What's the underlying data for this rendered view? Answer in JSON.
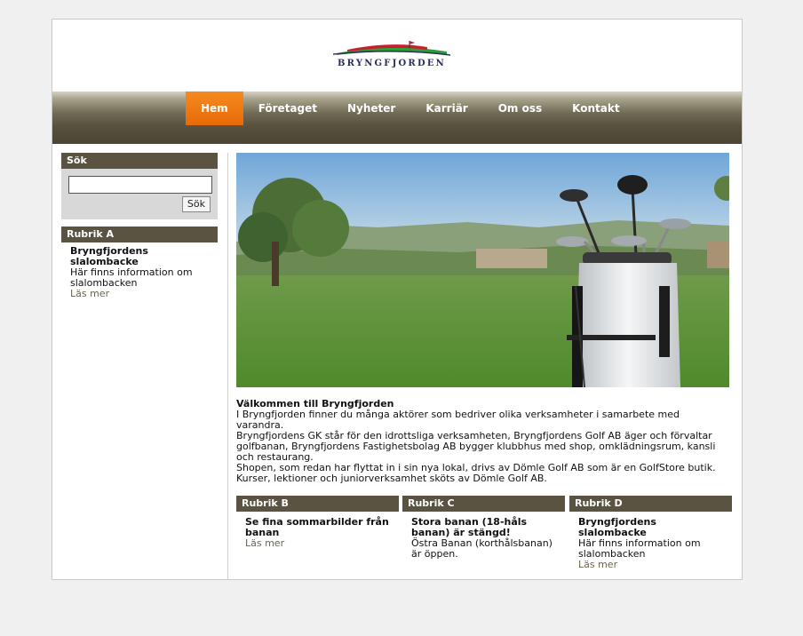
{
  "logo": {
    "text": "BRYNGFJORDEN"
  },
  "nav": {
    "items": [
      {
        "label": "Hem",
        "active": true
      },
      {
        "label": "Företaget"
      },
      {
        "label": "Nyheter"
      },
      {
        "label": "Karriär"
      },
      {
        "label": "Om oss"
      },
      {
        "label": "Kontakt"
      }
    ]
  },
  "search": {
    "title": "Sök",
    "value": "",
    "button": "Sök"
  },
  "rubrik_a": {
    "title": "Rubrik A",
    "heading": "Bryngfjordens slalombacke",
    "text": "Här finns information om slalombacken",
    "more": "Läs mer"
  },
  "welcome": {
    "title": "Välkommen till Bryngfjorden",
    "p1": "I Bryngfjorden finner du många aktörer som bedriver olika verksamheter i samarbete med varandra.",
    "p2": "Bryngfjordens GK står för den idrottsliga verksamheten, Bryngfjordens Golf AB äger och förvaltar golfbanan, Bryngfjordens Fastighetsbolag AB bygger klubbhus med shop, omklädningsrum, kansli och restaurang.",
    "p3": "Shopen, som redan har flyttat in i sin nya lokal, drivs av Dömle Golf AB som är en GolfStore butik. Kurser, lektioner och juniorverksamhet sköts av Dömle Golf AB."
  },
  "rubrik_b": {
    "title": "Rubrik B",
    "heading": "Se fina sommarbilder från banan",
    "more": "Läs mer"
  },
  "rubrik_c": {
    "title": "Rubrik C",
    "heading": "Stora banan (18-håls banan) är stängd!",
    "text": "Östra Banan (korthålsbanan) är öppen."
  },
  "rubrik_d": {
    "title": "Rubrik D",
    "heading": "Bryngfjordens slalombacke",
    "text": "Här finns information om slalombacken",
    "more": "Läs mer"
  },
  "colors": {
    "nav_active": "#f07a10",
    "box_header": "#5a5342",
    "link": "#6b6450"
  }
}
